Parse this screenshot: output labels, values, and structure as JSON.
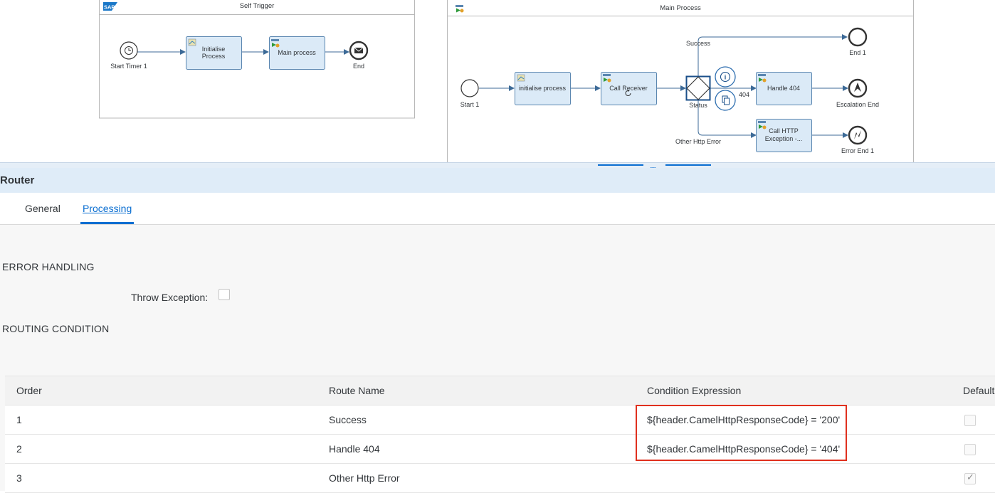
{
  "canvas": {
    "self_trigger": {
      "title": "Self Trigger",
      "sap_logo": "SAP",
      "start_timer": "Start Timer 1",
      "initialise_line1": "Initialise",
      "initialise_line2": "Process",
      "main_process": "Main process",
      "end": "End"
    },
    "main_process": {
      "title": "Main Process",
      "start": "Start 1",
      "initialise": "initialise process",
      "call_receiver": "Call Receiver",
      "router": "Status",
      "route_success": "Success",
      "route_404": "404",
      "route_other": "Other Http Error",
      "handle_404": "Handle 404",
      "call_http_line1": "Call HTTP",
      "call_http_line2": "Exception -...",
      "end1": "End 1",
      "escalation_end": "Escalation End",
      "error_end": "Error End 1"
    },
    "icons": [
      "timer-icon",
      "envelope-icon",
      "info-icon",
      "copy-icon",
      "escalation-icon",
      "lightning-icon",
      "script-icon",
      "process-call-icon",
      "refresh-icon"
    ]
  },
  "splitter": {
    "grip": "....."
  },
  "properties": {
    "title": "Router",
    "tabs": [
      {
        "label": "General",
        "active": false
      },
      {
        "label": "Processing",
        "active": true
      }
    ],
    "error_handling": {
      "title": "ERROR HANDLING",
      "throw_exception_label": "Throw Exception:",
      "throw_exception_checked": false
    },
    "routing_condition": {
      "title": "ROUTING CONDITION",
      "columns": [
        "Order",
        "Route Name",
        "Condition Expression",
        "Default"
      ],
      "rows": [
        {
          "order": "1",
          "route_name": "Success",
          "condition": "${header.CamelHttpResponseCode} = '200'",
          "default": false
        },
        {
          "order": "2",
          "route_name": "Handle 404",
          "condition": "${header.CamelHttpResponseCode} = '404'",
          "default": false
        },
        {
          "order": "3",
          "route_name": "Other Http Error",
          "condition": "",
          "default": true
        }
      ]
    }
  },
  "colors": {
    "accent": "#0a6ed1",
    "header_bg": "#dfecf8",
    "task_fill": "#dbeaf7",
    "task_border": "#5a86b0",
    "highlight": "#e0301e"
  }
}
